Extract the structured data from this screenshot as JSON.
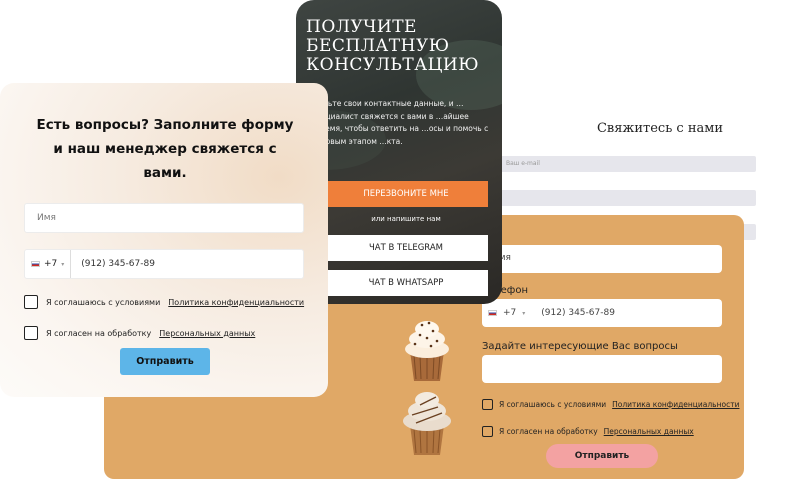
{
  "back_card": {
    "title": "Свяжитесь с нами",
    "field_hint": "Ваш e-mail"
  },
  "orange_card": {
    "name_placeholder": "Имя",
    "phone_label": "Телефон",
    "country_code": "+7",
    "phone_placeholder": "(912) 345-67-89",
    "question_label": "Задайте интересующие Вас вопросы",
    "consent1_text": "Я соглашаюсь с условиями",
    "consent1_link": "Политика конфиденциальности",
    "consent2_text": "Я согласен на обработку",
    "consent2_link": "Персональных данных",
    "submit_label": "Отправить",
    "colors": {
      "background": "#e0a866",
      "button": "#f3a2a2"
    }
  },
  "dark_card": {
    "title": "ПОЛУЧИТЕ БЕСПЛАТНУЮ КОНСУЛЬТАЦИЮ",
    "description": "…вьте свои контактные данные, и …пециалист свяжется с вами в …айшее время, чтобы ответить на …осы и помочь с первым этапом …кта.",
    "call_button": "ПЕРЕЗВОНИТЕ МНЕ",
    "or_write": "или напишите нам",
    "telegram_button": "ЧАТ В TELEGRAM",
    "whatsapp_button": "ЧАТ В WHATSAPP",
    "colors": {
      "accent": "#ef7f3a"
    }
  },
  "front_card": {
    "heading": "Есть вопросы? Заполните форму и наш менеджер свяжется с вами.",
    "name_placeholder": "Имя",
    "country_code": "+7",
    "phone_placeholder": "(912) 345-67-89",
    "consent1_text": "Я соглашаюсь с условиями",
    "consent1_link": "Политика конфиденциальности",
    "consent2_text": "Я согласен на обработку",
    "consent2_link": "Персональных данных",
    "submit_label": "Отправить",
    "colors": {
      "button": "#5db5e8"
    }
  }
}
